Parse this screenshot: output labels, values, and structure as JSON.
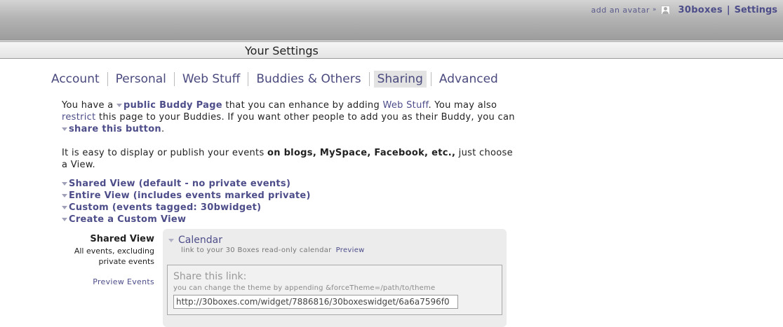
{
  "header": {
    "add_avatar": "add an avatar",
    "arrow": "»",
    "brand": "30boxes",
    "separator": "|",
    "settings": "Settings"
  },
  "titlebar": {
    "title": "Your Settings"
  },
  "tabs": [
    {
      "label": "Account"
    },
    {
      "label": "Personal"
    },
    {
      "label": "Web Stuff"
    },
    {
      "label": "Buddies & Others"
    },
    {
      "label": "Sharing",
      "active": true
    },
    {
      "label": "Advanced"
    }
  ],
  "intro": {
    "t1": "You have a ",
    "buddy_page": "public Buddy Page",
    "t2": " that you can enhance by adding ",
    "web_stuff": "Web Stuff",
    "t3": ". You may also ",
    "restrict": "restrict",
    "t4": " this page to your Buddies. If you want other people to add you as their Buddy, you can ",
    "share_button": "share this button",
    "t5": "."
  },
  "publish": {
    "t1": "It is easy to display or publish your events ",
    "bold": "on blogs, MySpace, Facebook, etc.,",
    "t2": " just choose a View."
  },
  "views": [
    "Shared View (default - no private events)",
    "Entire View (includes events marked private)",
    "Custom (events tagged: 30bwidget)",
    "Create a Custom View"
  ],
  "shared_view": {
    "title": "Shared View",
    "desc_line1": "All events, excluding",
    "desc_line2": "private events",
    "preview_events": "Preview Events"
  },
  "panel": {
    "calendar_label": "Calendar",
    "calendar_sub": "link to your 30 Boxes read-only calendar",
    "preview": "Preview",
    "share_title": "Share this link:",
    "share_hint": "you can change the theme by appending &forceTheme=/path/to/theme",
    "share_url": "http://30boxes.com/widget/7886816/30boxeswidget/6a6a7596f0"
  }
}
